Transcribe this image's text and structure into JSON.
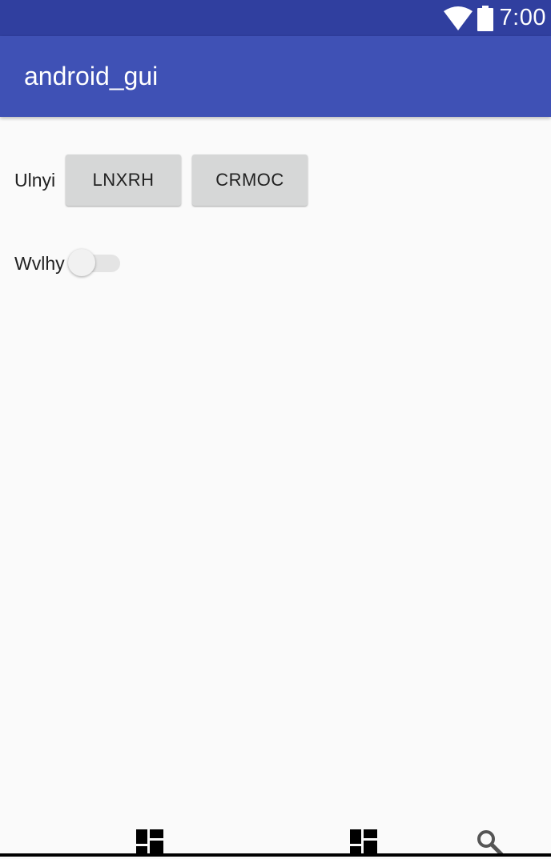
{
  "status_bar": {
    "time": "7:00",
    "icons": [
      "wifi-icon",
      "battery-icon"
    ],
    "background": "#303f9f"
  },
  "app_bar": {
    "title": "android_gui",
    "background": "#3f51b5"
  },
  "main": {
    "row1": {
      "label": "Ulnyi",
      "buttons": [
        "LNXRH",
        "CRMOC"
      ]
    },
    "row2": {
      "label": "Wvlhy",
      "switch_on": false
    }
  },
  "bottom_bar": {
    "icons": [
      "dashboard-icon",
      "dashboard-icon",
      "search-icon"
    ]
  }
}
